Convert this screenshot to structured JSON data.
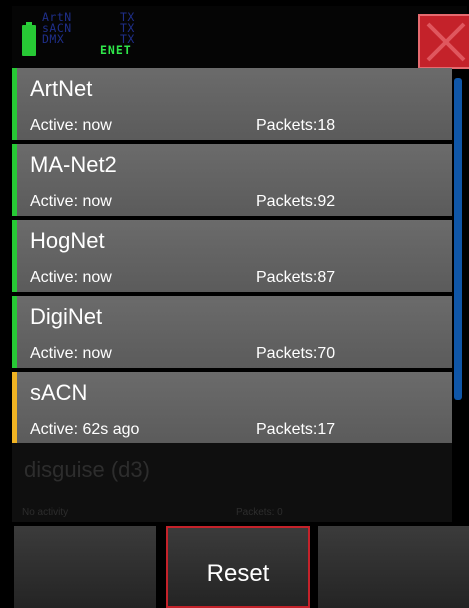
{
  "header": {
    "protocols": [
      {
        "name": "ArtN",
        "status": "TX"
      },
      {
        "name": "sACN",
        "status": "TX"
      },
      {
        "name": "DMX",
        "status": "TX"
      }
    ],
    "network_label": "ENET",
    "battery_icon": "battery-icon",
    "close_icon": "close-icon"
  },
  "colors": {
    "active": "#27c935",
    "idle": "#f0b323",
    "accent": "#c4222a",
    "scroll": "#0f56a8"
  },
  "items": [
    {
      "name": "ArtNet",
      "status": "Active: now",
      "packets": "Packets:18",
      "state": "active"
    },
    {
      "name": "MA-Net2",
      "status": "Active: now",
      "packets": "Packets:92",
      "state": "active"
    },
    {
      "name": "HogNet",
      "status": "Active: now",
      "packets": "Packets:87",
      "state": "active"
    },
    {
      "name": "DigiNet",
      "status": "Active: now",
      "packets": "Packets:70",
      "state": "active"
    },
    {
      "name": "sACN",
      "status": "Active: 62s ago",
      "packets": "Packets:17",
      "state": "idle"
    }
  ],
  "disabled_item": {
    "name": "disguise (d3)",
    "status": "No activity",
    "packets": "Packets: 0"
  },
  "buttons": {
    "reset_label": "Reset"
  }
}
